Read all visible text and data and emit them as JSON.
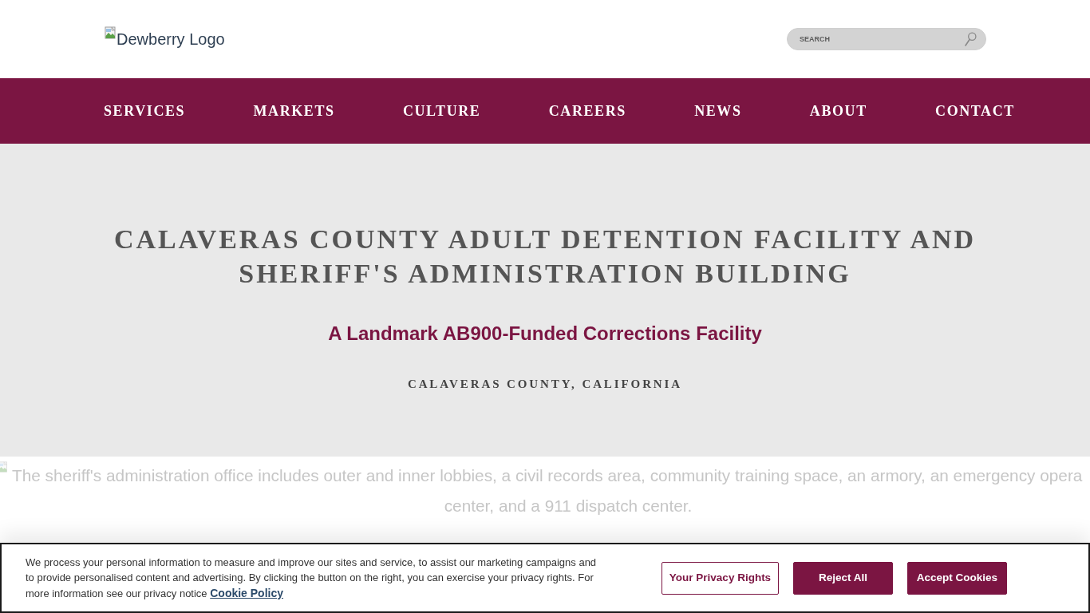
{
  "header": {
    "logo_alt_text": "Dewberry Logo",
    "search": {
      "placeholder": "SEARCH"
    }
  },
  "nav": {
    "items": [
      "SERVICES",
      "MARKETS",
      "CULTURE",
      "CAREERS",
      "NEWS",
      "ABOUT",
      "CONTACT"
    ]
  },
  "hero": {
    "title": "CALAVERAS COUNTY ADULT DETENTION FACILITY AND SHERIFF'S ADMINISTRATION BUILDING",
    "subtitle": "A Landmark AB900-Funded Corrections Facility",
    "location": "CALAVERAS COUNTY, CALIFORNIA"
  },
  "caption": {
    "lines": [
      "The sheriff's administration office includes outer and inner lobbies, a civil records area, community training space, an armory, an emergency opera",
      "center, and a 911 dispatch center."
    ]
  },
  "cookie_banner": {
    "text": "We process your personal information to measure and improve our sites and service, to assist our marketing campaigns and to provide personalised content and advertising. By clicking the button on the right, you can exercise your privacy rights. For more information see our privacy notice",
    "link": "Cookie Policy",
    "buttons": [
      {
        "label": "Your Privacy Rights",
        "kind": "outline"
      },
      {
        "label": "Reject All",
        "kind": "filled"
      },
      {
        "label": "Accept Cookies",
        "kind": "filled"
      }
    ]
  }
}
